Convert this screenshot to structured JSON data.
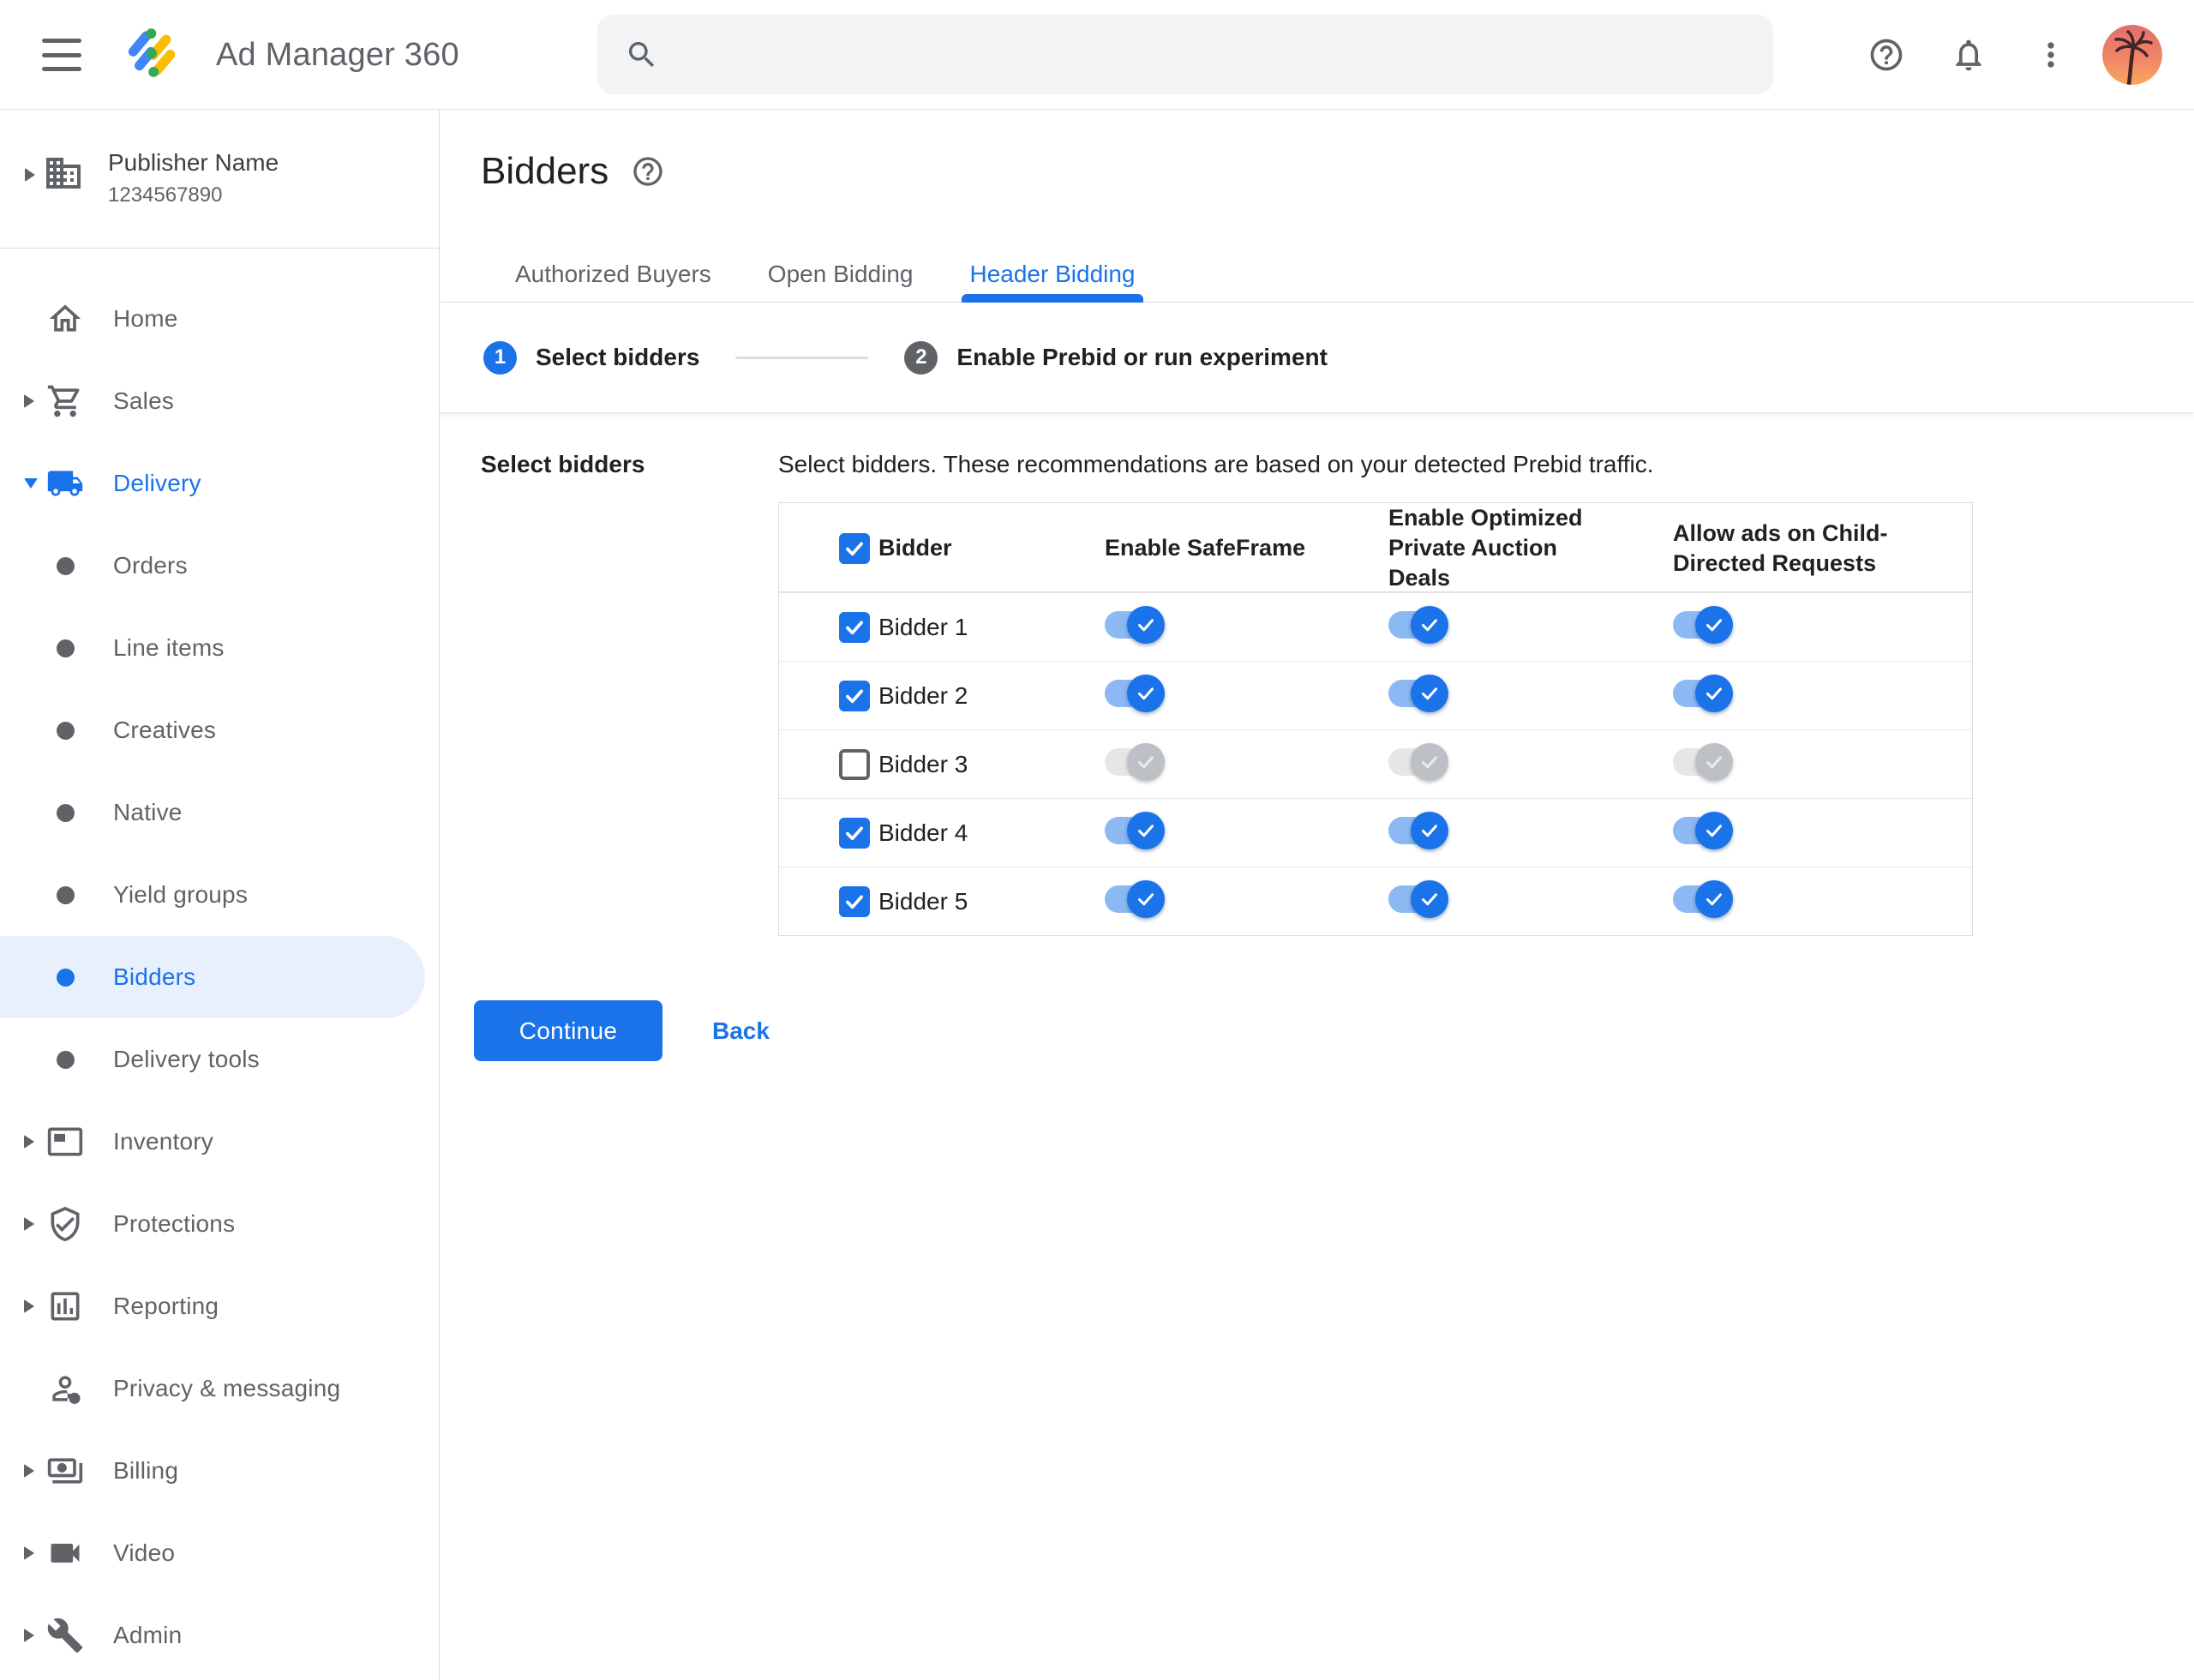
{
  "colors": {
    "primary_blue": "#1a73e8",
    "logo_blue": "#4285f4",
    "logo_yellow": "#fbbc04",
    "logo_green": "#34a853",
    "toggle_track_on": "#8cb9f3",
    "toggle_disabled_thumb": "#bdc1c6",
    "selected_item_bg": "#e8f0fe",
    "text_primary": "#202124",
    "text_secondary": "#5f6368",
    "border": "#dadce0",
    "search_bg": "#f1f3f4"
  },
  "header": {
    "product_name": "Ad Manager 360",
    "search": {
      "value": "",
      "placeholder": ""
    },
    "icons": [
      "hamburger-menu-icon",
      "ad-manager-logo",
      "search-icon",
      "help-icon",
      "notifications-bell-icon",
      "kebab-menu-icon",
      "user-avatar"
    ]
  },
  "account": {
    "name": "Publisher Name",
    "id": "1234567890"
  },
  "sidebar": {
    "items": [
      {
        "label": "Home",
        "icon": "home-icon",
        "level": "top",
        "expandable": false
      },
      {
        "label": "Sales",
        "icon": "shopping-cart-icon",
        "level": "top",
        "expandable": true
      },
      {
        "label": "Delivery",
        "icon": "delivery-truck-icon",
        "level": "top",
        "expandable": true,
        "expanded": true,
        "highlighted": true
      },
      {
        "label": "Orders",
        "icon": "bullet",
        "level": "sub"
      },
      {
        "label": "Line items",
        "icon": "bullet",
        "level": "sub"
      },
      {
        "label": "Creatives",
        "icon": "bullet",
        "level": "sub"
      },
      {
        "label": "Native",
        "icon": "bullet",
        "level": "sub"
      },
      {
        "label": "Yield groups",
        "icon": "bullet",
        "level": "sub"
      },
      {
        "label": "Bidders",
        "icon": "bullet",
        "level": "sub",
        "selected": true
      },
      {
        "label": "Delivery tools",
        "icon": "bullet",
        "level": "sub"
      },
      {
        "label": "Inventory",
        "icon": "inventory-icon",
        "level": "top",
        "expandable": true
      },
      {
        "label": "Protections",
        "icon": "shield-check-icon",
        "level": "top",
        "expandable": true
      },
      {
        "label": "Reporting",
        "icon": "bar-chart-icon",
        "level": "top",
        "expandable": true
      },
      {
        "label": "Privacy & messaging",
        "icon": "person-badge-icon",
        "level": "top",
        "expandable": false
      },
      {
        "label": "Billing",
        "icon": "payments-icon",
        "level": "top",
        "expandable": true
      },
      {
        "label": "Video",
        "icon": "video-camera-icon",
        "level": "top",
        "expandable": true
      },
      {
        "label": "Admin",
        "icon": "wrench-icon",
        "level": "top",
        "expandable": true
      }
    ]
  },
  "page": {
    "title": "Bidders"
  },
  "tabs": {
    "items": [
      {
        "label": "Authorized Buyers",
        "active": false
      },
      {
        "label": "Open Bidding",
        "active": false
      },
      {
        "label": "Header Bidding",
        "active": true
      }
    ]
  },
  "stepper": {
    "steps": [
      {
        "number": "1",
        "label": "Select bidders",
        "state": "active"
      },
      {
        "number": "2",
        "label": "Enable Prebid or run experiment",
        "state": "upcoming"
      }
    ]
  },
  "form": {
    "section_label": "Select bidders",
    "description": "Select bidders. These recommendations are based on your detected Prebid traffic."
  },
  "table": {
    "header": {
      "checkbox_checked": true,
      "columns": [
        "Bidder",
        "Enable SafeFrame",
        "Enable Optimized Private Auction Deals",
        "Allow ads on Child-Directed Requests"
      ]
    },
    "rows": [
      {
        "name": "Bidder 1",
        "selected": true,
        "enabled": true,
        "toggles": {
          "safeframe": true,
          "optimized_private_auction": true,
          "child_directed": true
        }
      },
      {
        "name": "Bidder 2",
        "selected": true,
        "enabled": true,
        "toggles": {
          "safeframe": true,
          "optimized_private_auction": true,
          "child_directed": true
        }
      },
      {
        "name": "Bidder 3",
        "selected": false,
        "enabled": false,
        "toggles": {
          "safeframe": true,
          "optimized_private_auction": true,
          "child_directed": true
        }
      },
      {
        "name": "Bidder 4",
        "selected": true,
        "enabled": true,
        "toggles": {
          "safeframe": true,
          "optimized_private_auction": true,
          "child_directed": true
        }
      },
      {
        "name": "Bidder 5",
        "selected": true,
        "enabled": true,
        "toggles": {
          "safeframe": true,
          "optimized_private_auction": true,
          "child_directed": true
        }
      }
    ]
  },
  "actions": {
    "continue_label": "Continue",
    "back_label": "Back"
  }
}
